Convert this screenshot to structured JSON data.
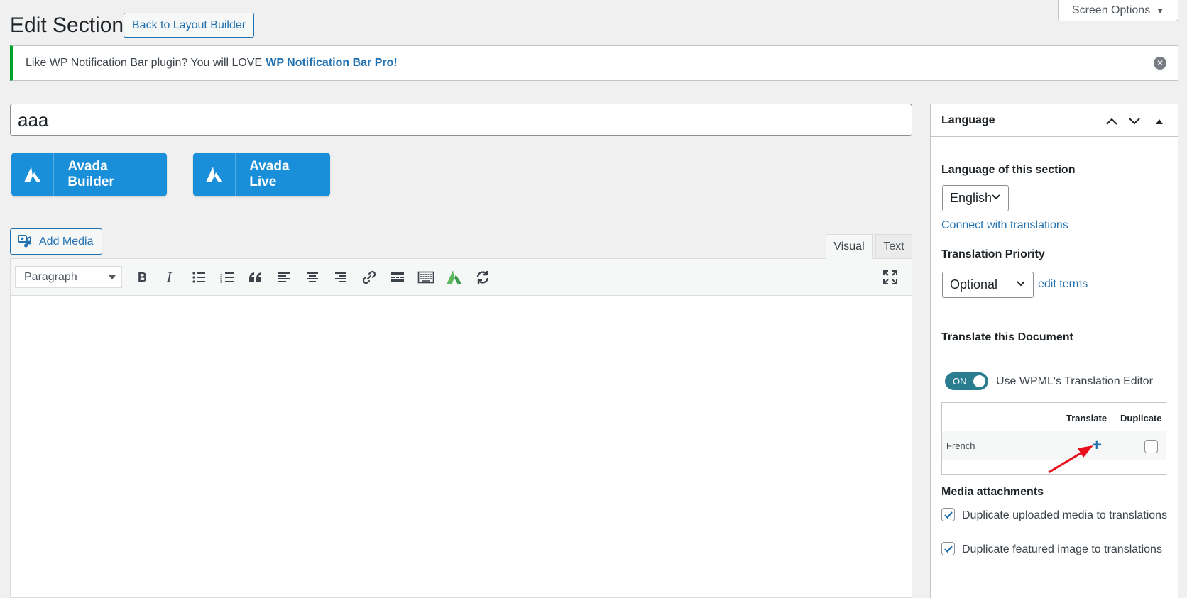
{
  "header": {
    "title": "Edit Section",
    "back_label": "Back to Layout Builder",
    "screen_options": "Screen Options"
  },
  "notice": {
    "text": "Like WP Notification Bar plugin? You will LOVE",
    "link": "WP Notification Bar Pro!"
  },
  "post": {
    "title_value": "aaa"
  },
  "avada": {
    "builder_label": "Avada Builder",
    "live_label": "Avada Live"
  },
  "editor": {
    "add_media_label": "Add Media",
    "tab_visual": "Visual",
    "tab_text": "Text",
    "format_value": "Paragraph"
  },
  "language_box": {
    "title": "Language",
    "language_label": "Language of this section",
    "language_value": "English",
    "connect_link": "Connect with translations",
    "priority_label": "Translation Priority",
    "priority_value": "Optional",
    "edit_terms_link": "edit terms",
    "translate_doc_label": "Translate this Document",
    "toggle_state": "ON",
    "toggle_label": "Use WPML's Translation Editor",
    "table": {
      "col_translate": "Translate",
      "col_duplicate": "Duplicate",
      "rows": [
        {
          "language": "French"
        }
      ]
    },
    "media_label": "Media attachments",
    "media_option_1": "Duplicate uploaded media to translations",
    "media_option_2": "Duplicate featured image to translations"
  },
  "colors": {
    "accent": "#2271b1",
    "avada_blue": "#198fd9",
    "notice_green": "#00a32a",
    "toggle_teal": "#2a7c8f",
    "annotation_red": "#e8101a"
  }
}
